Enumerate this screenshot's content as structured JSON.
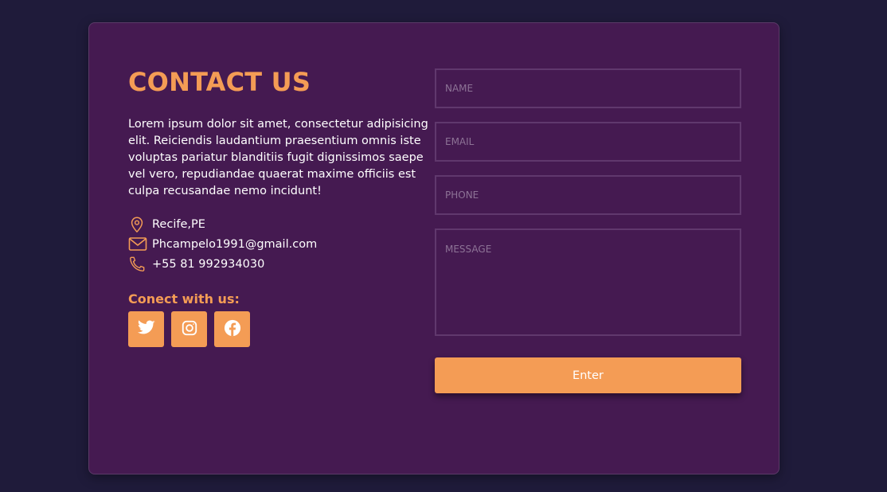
{
  "contact": {
    "title": "CONTACT US",
    "description": "Lorem ipsum dolor sit amet, consectetur adipisicing elit. Reiciendis laudantium praesentium omnis iste voluptas pariatur blanditiis fugit dignissimos saepe vel vero, repudiandae quaerat maxime officiis est culpa recusandae nemo incidunt!",
    "location": "Recife,PE",
    "email": "Phcampelo1991@gmail.com",
    "phone": "+55 81 992934030",
    "connect_label": "Conect with us:",
    "socials": [
      {
        "icon": "twitter-icon"
      },
      {
        "icon": "instagram-icon"
      },
      {
        "icon": "facebook-icon"
      }
    ]
  },
  "form": {
    "name_placeholder": "NAME",
    "email_placeholder": "EMAIL",
    "phone_placeholder": "PHONE",
    "message_placeholder": "MESSAGE",
    "submit_label": "Enter"
  },
  "colors": {
    "background": "#1f1b3a",
    "card": "#451a51",
    "accent": "#f49c55",
    "field_border": "#60386d",
    "text": "#ffffff"
  }
}
